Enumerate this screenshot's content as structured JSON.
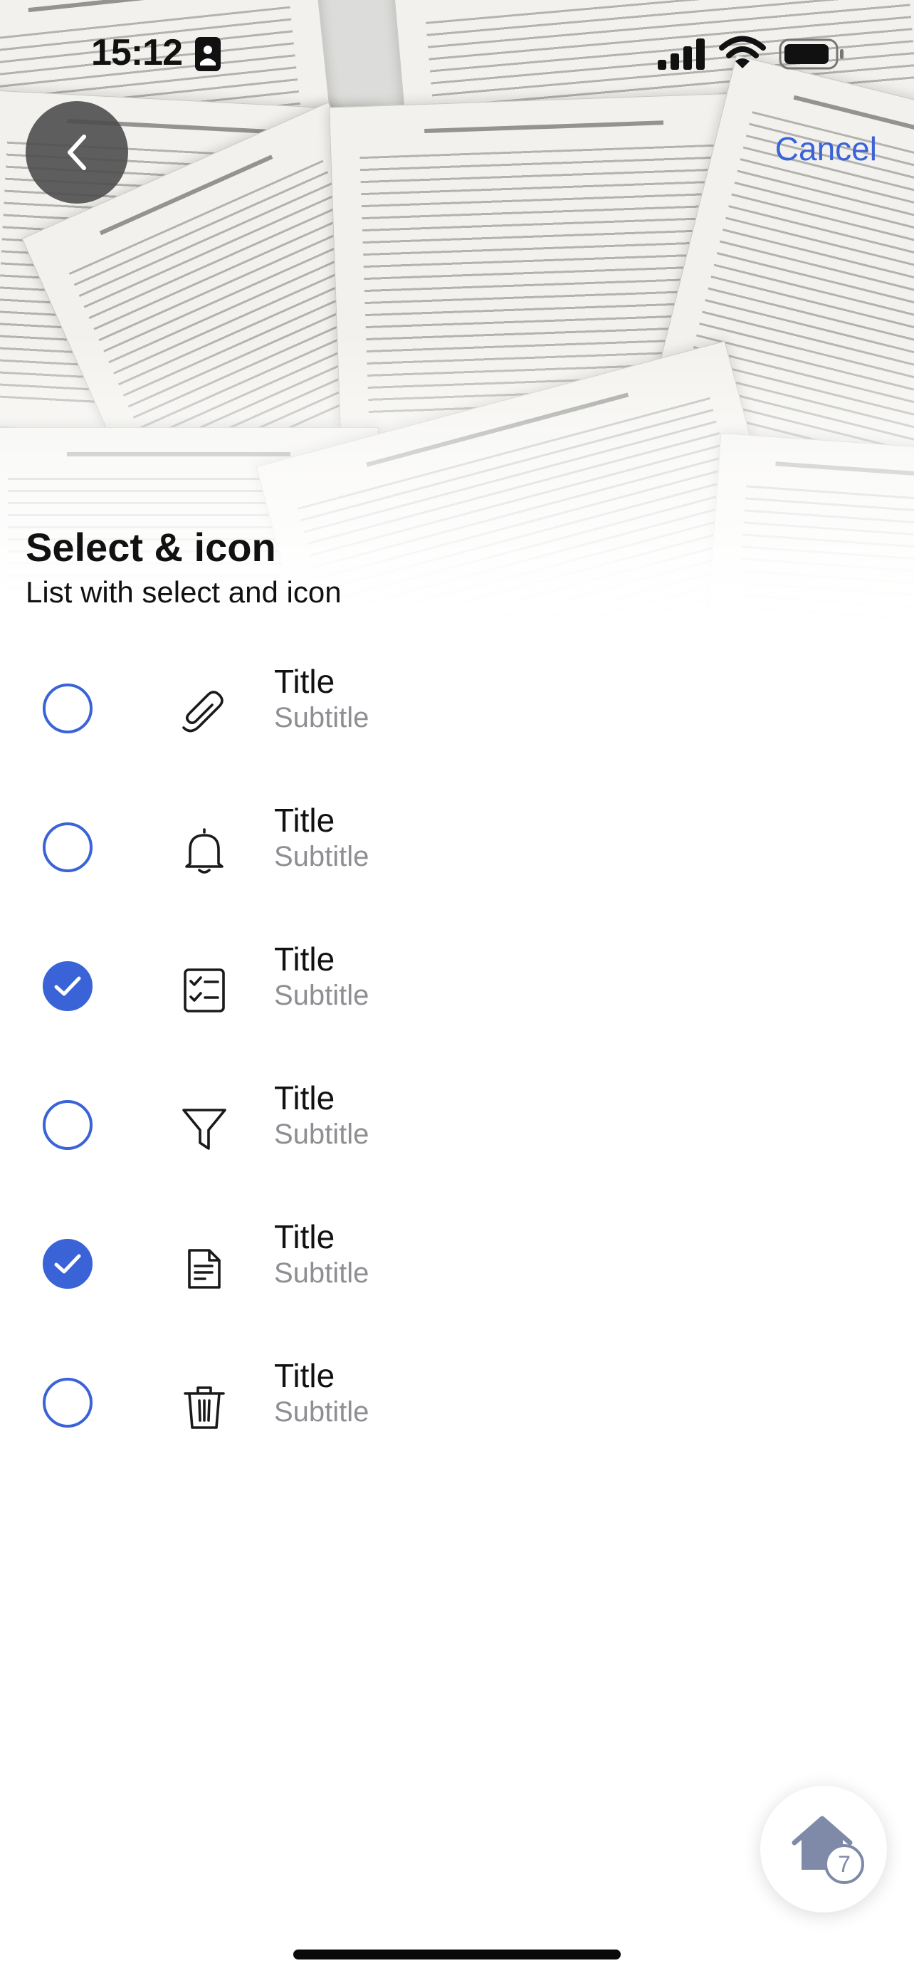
{
  "status_bar": {
    "time": "15:12"
  },
  "nav": {
    "back_icon": "chevron-left-icon",
    "cancel_label": "Cancel"
  },
  "header": {
    "title": "Select & icon",
    "subtitle": "List with select and icon"
  },
  "list": {
    "items": [
      {
        "title": "Title",
        "subtitle": "Subtitle",
        "icon": "paperclip-icon",
        "selected": false
      },
      {
        "title": "Title",
        "subtitle": "Subtitle",
        "icon": "bell-icon",
        "selected": false
      },
      {
        "title": "Title",
        "subtitle": "Subtitle",
        "icon": "checklist-icon",
        "selected": true
      },
      {
        "title": "Title",
        "subtitle": "Subtitle",
        "icon": "filter-icon",
        "selected": false
      },
      {
        "title": "Title",
        "subtitle": "Subtitle",
        "icon": "document-icon",
        "selected": true
      },
      {
        "title": "Title",
        "subtitle": "Subtitle",
        "icon": "trash-icon",
        "selected": false
      }
    ]
  },
  "home_button": {
    "icon": "home-icon",
    "badge": "7"
  },
  "colors": {
    "accent": "#3a63d8",
    "subtitle": "#8e8e93",
    "badge": "#7e8aa8"
  }
}
